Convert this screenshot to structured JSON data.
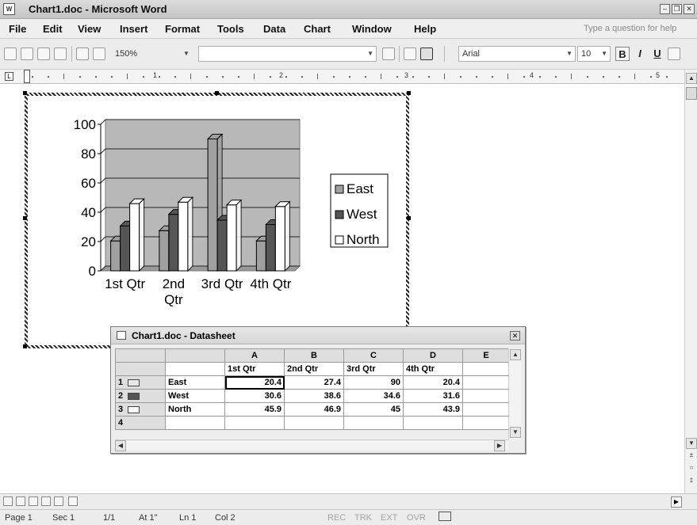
{
  "window": {
    "title": "Chart1.doc - Microsoft Word"
  },
  "menu": {
    "items": [
      "File",
      "Edit",
      "View",
      "Insert",
      "Format",
      "Tools",
      "Data",
      "Chart",
      "Window",
      "Help"
    ],
    "help_placeholder": "Type a question for help"
  },
  "toolbar": {
    "zoom": "150%",
    "font": "Arial",
    "font_size": "10",
    "bold": "B",
    "italic": "I",
    "underline": "U"
  },
  "ruler": {
    "numbers": [
      "1",
      "2",
      "3",
      "4",
      "5"
    ]
  },
  "chart_data": {
    "type": "bar",
    "categories": [
      "1st Qtr",
      "2nd Qtr",
      "3rd Qtr",
      "4th Qtr"
    ],
    "category_labels": [
      "1st Qtr",
      "2nd",
      "Qtr",
      "3rd Qtr",
      "4th Qtr"
    ],
    "series": [
      {
        "name": "East",
        "values": [
          20.4,
          27.4,
          90,
          20.4
        ],
        "color": "#a0a0a0"
      },
      {
        "name": "West",
        "values": [
          30.6,
          38.6,
          34.6,
          31.6
        ],
        "color": "#555555"
      },
      {
        "name": "North",
        "values": [
          45.9,
          46.9,
          45,
          43.9
        ],
        "color": "#ffffff"
      }
    ],
    "ylim": [
      0,
      100
    ],
    "yticks": [
      "100",
      "80",
      "60",
      "40",
      "20",
      "0"
    ],
    "grid": true,
    "legend": "right",
    "plot_background": "#b8b8b8"
  },
  "datasheet": {
    "title": "Chart1.doc - Datasheet",
    "columns": [
      "A",
      "B",
      "C",
      "D",
      "E"
    ],
    "header_row": [
      "1st Qtr",
      "2nd Qtr",
      "3rd Qtr",
      "4th Qtr"
    ],
    "rows": [
      {
        "num": "1",
        "label": "East",
        "values": [
          "20.4",
          "27.4",
          "90",
          "20.4"
        ]
      },
      {
        "num": "2",
        "label": "West",
        "values": [
          "30.6",
          "38.6",
          "34.6",
          "31.6"
        ]
      },
      {
        "num": "3",
        "label": "North",
        "values": [
          "45.9",
          "46.9",
          "45",
          "43.9"
        ]
      },
      {
        "num": "4",
        "label": "",
        "values": [
          "",
          "",
          "",
          ""
        ]
      }
    ]
  },
  "status": {
    "page": "Page 1",
    "sec": "Sec 1",
    "pages": "1/1",
    "at": "At 1\"",
    "ln": "Ln 1",
    "col": "Col 2",
    "rec": "REC",
    "trk": "TRK",
    "ext": "EXT",
    "ovr": "OVR"
  }
}
